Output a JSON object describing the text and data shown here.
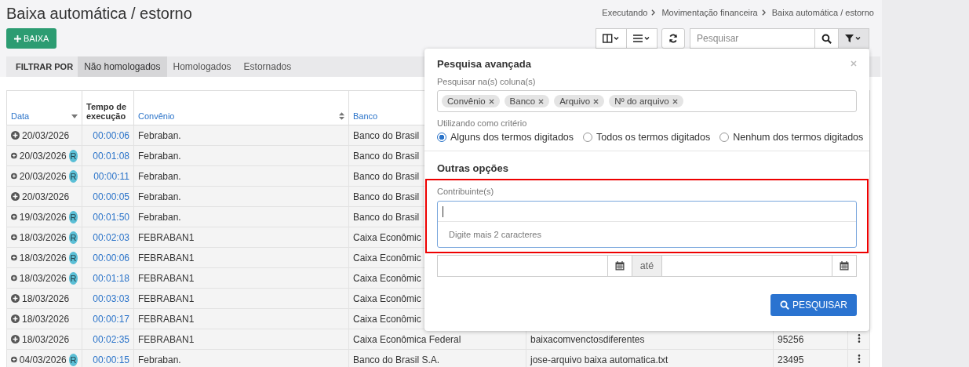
{
  "page": {
    "title": "Baixa automática / estorno"
  },
  "breadcrumb": [
    "Executando",
    "Movimentação financeira",
    "Baixa automática / estorno"
  ],
  "add_button": {
    "label": "BAIXA"
  },
  "toolbar": {
    "search": {
      "placeholder": "Pesquisar"
    },
    "filter_active": true
  },
  "filter_bar": {
    "label": "FILTRAR POR",
    "tabs": [
      {
        "label": "Não homologados",
        "selected": true
      },
      {
        "label": "Homologados",
        "selected": false
      },
      {
        "label": "Estornados",
        "selected": false
      }
    ]
  },
  "table": {
    "columns": [
      {
        "label": "Data",
        "kind": "sorted"
      },
      {
        "label": "Tempo de execução",
        "kind": "plain"
      },
      {
        "label": "Convênio",
        "kind": "sortable"
      },
      {
        "label": "Banco",
        "kind": "link"
      }
    ],
    "rows": [
      {
        "date": "20/03/2026",
        "duration": "00:00:06",
        "agreement": "Febraban.",
        "bank": "Banco do Brasil"
      },
      {
        "date": "20/03/2026",
        "badge": "R",
        "duration": "00:01:08",
        "agreement": "Febraban.",
        "bank": "Banco do Brasil"
      },
      {
        "date": "20/03/2026",
        "badge": "R",
        "duration": "00:00:11",
        "agreement": "Febraban.",
        "bank": "Banco do Brasil"
      },
      {
        "date": "20/03/2026",
        "duration": "00:00:05",
        "agreement": "Febraban.",
        "bank": "Banco do Brasil"
      },
      {
        "date": "19/03/2026",
        "badge": "R",
        "duration": "00:01:50",
        "agreement": "Febraban.",
        "bank": "Banco do Brasil"
      },
      {
        "date": "18/03/2026",
        "badge": "R",
        "duration": "00:02:03",
        "agreement": "FEBRABAN1",
        "bank": "Caixa Econômic"
      },
      {
        "date": "18/03/2026",
        "badge": "R",
        "duration": "00:00:06",
        "agreement": "FEBRABAN1",
        "bank": "Caixa Econômic"
      },
      {
        "date": "18/03/2026",
        "badge": "R",
        "duration": "00:01:18",
        "agreement": "FEBRABAN1",
        "bank": "Caixa Econômic"
      },
      {
        "date": "18/03/2026",
        "duration": "00:03:03",
        "agreement": "FEBRABAN1",
        "bank": "Caixa Econômic"
      },
      {
        "date": "18/03/2026",
        "duration": "00:00:17",
        "agreement": "FEBRABAN1",
        "bank": "Caixa Econômic"
      },
      {
        "date": "18/03/2026",
        "duration": "00:02:35",
        "agreement": "FEBRABAN1",
        "bank": "Caixa Econômica Federal",
        "file": "baixacomvenctosdiferentes",
        "number": "95256",
        "actions": true
      },
      {
        "date": "04/03/2026",
        "badge": "R",
        "duration": "00:00:15",
        "agreement": "Febraban.",
        "bank": "Banco do Brasil S.A.",
        "file": "jose-arquivo baixa automatica.txt",
        "number": "23495",
        "actions": true
      }
    ]
  },
  "advanced_search": {
    "title": "Pesquisa avançada",
    "columns_label": "Pesquisar na(s) coluna(s)",
    "column_tags": [
      "Convênio",
      "Banco",
      "Arquivo",
      "Nº do arquivo"
    ],
    "criteria_label": "Utilizando como critério",
    "criteria": [
      {
        "label": "Alguns dos termos digitados",
        "selected": true
      },
      {
        "label": "Todos os termos digitados",
        "selected": false
      },
      {
        "label": "Nenhum dos termos digitados",
        "selected": false
      }
    ],
    "other_title": "Outras opções",
    "taxpayer": {
      "label": "Contribuinte(s)",
      "focused": true,
      "highlighted": true,
      "message": "Digite mais 2 caracteres"
    },
    "date_range": {
      "separator": "até"
    },
    "submit": "PESQUISAR"
  }
}
